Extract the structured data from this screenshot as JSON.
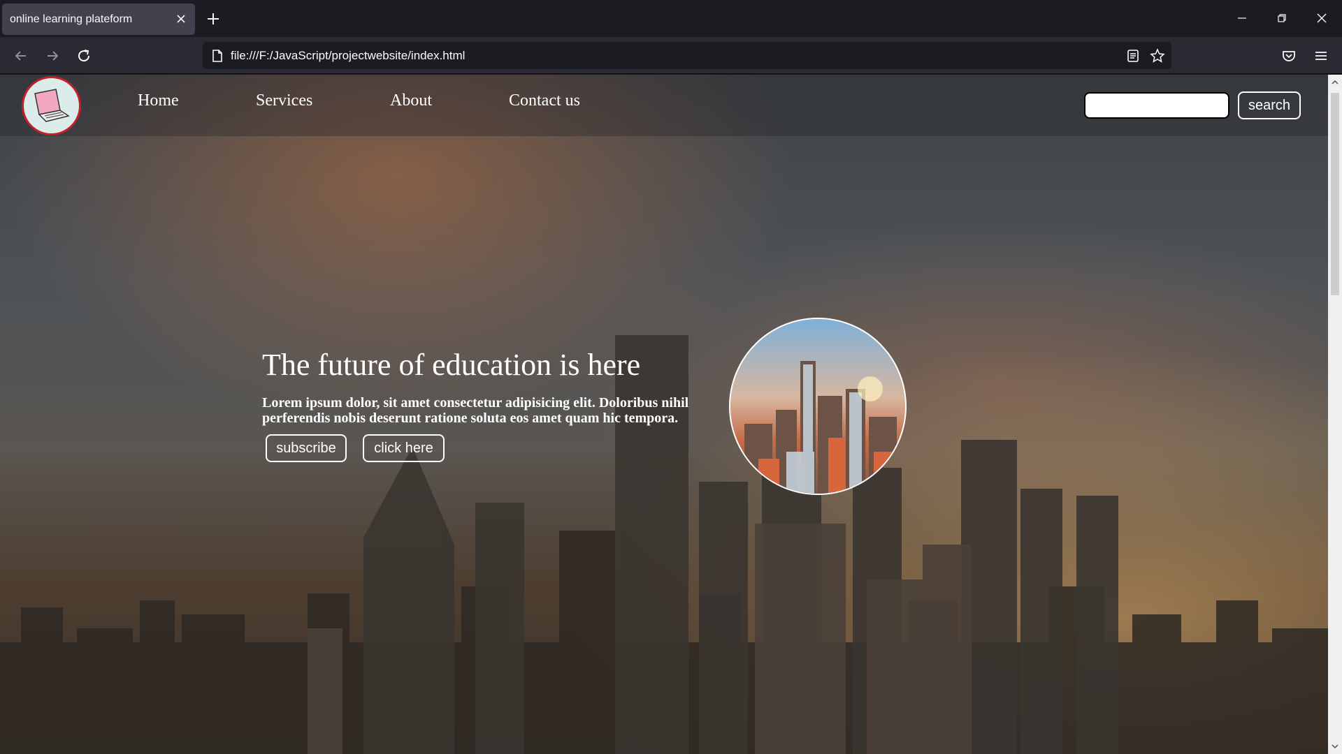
{
  "browser": {
    "tab_title": "online learning plateform",
    "url": "file:///F:/JavaScript/projectwebsite/index.html"
  },
  "site": {
    "nav": [
      "Home",
      "Services",
      "About",
      "Contact us"
    ],
    "search_placeholder": "",
    "search_button": "search",
    "hero": {
      "title": "The future of education is here",
      "text": "Lorem ipsum dolor, sit amet consectetur adipisicing elit. Doloribus nihil perferendis nobis deserunt ratione soluta eos amet quam hic tempora.",
      "buttons": [
        "subscribe",
        "click here"
      ]
    }
  },
  "icons": [
    "back-icon",
    "forward-icon",
    "reload-icon",
    "page-icon",
    "reader-view-icon",
    "bookmark-star-icon",
    "pocket-icon",
    "menu-icon",
    "close-icon",
    "new-tab-icon",
    "minimize-icon",
    "restore-icon",
    "window-close-icon"
  ]
}
